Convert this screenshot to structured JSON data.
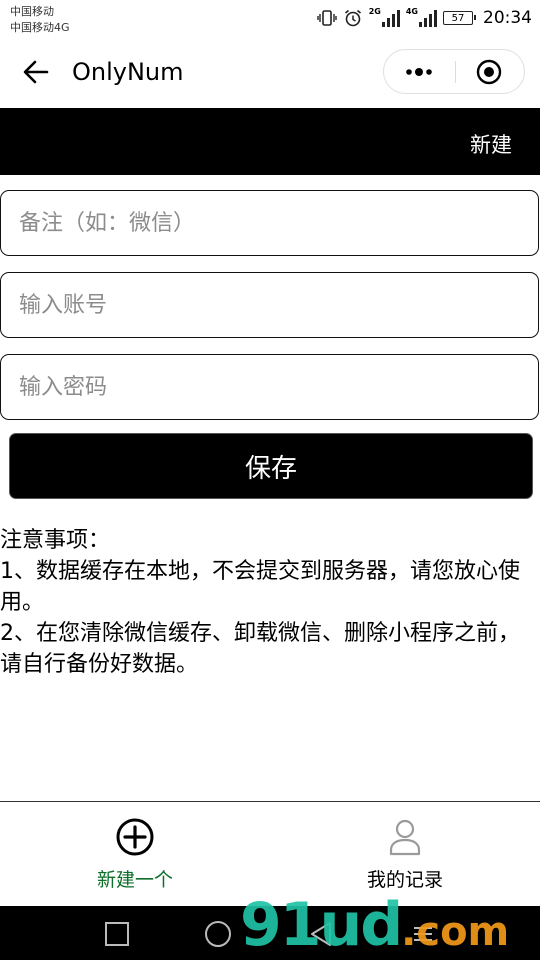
{
  "status_bar": {
    "carrier_1": "中国移动",
    "carrier_2": "中国移动4G",
    "net_1": "2G",
    "net_2": "4G",
    "battery": "57",
    "time": "20:34"
  },
  "nav": {
    "title": "OnlyNum"
  },
  "header": {
    "new_label": "新建"
  },
  "form": {
    "remark_placeholder": "备注（如：微信）",
    "account_placeholder": "输入账号",
    "password_placeholder": "输入密码",
    "save_label": "保存"
  },
  "notes": {
    "title": "注意事项：",
    "item_1": "1、数据缓存在本地，不会提交到服务器，请您放心使用。",
    "item_2": "2、在您清除微信缓存、卸载微信、删除小程序之前，请自行备份好数据。"
  },
  "tabs": [
    {
      "label": "新建一个",
      "icon": "plus-circle-icon",
      "active": true,
      "color": "#0d6e2a"
    },
    {
      "label": "我的记录",
      "icon": "user-icon",
      "active": false,
      "color": "#000000"
    }
  ],
  "watermark": {
    "text": "91ud",
    "tail": ".com"
  },
  "colors": {
    "header_bg": "#000000",
    "active_tab": "#0d6e2a"
  }
}
